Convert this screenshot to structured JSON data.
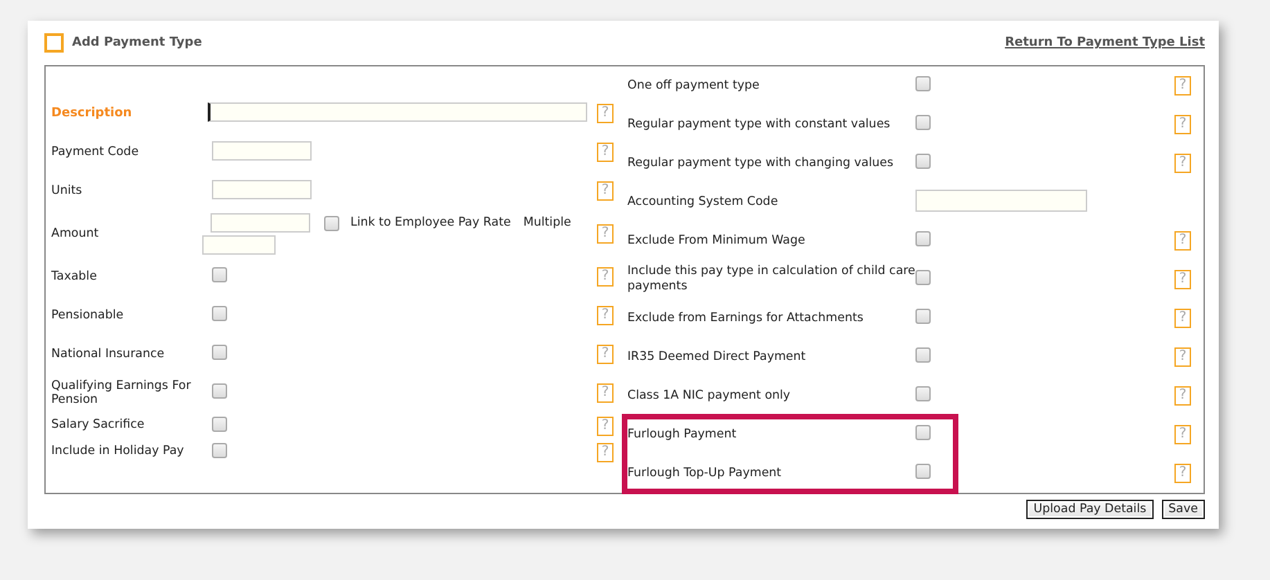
{
  "header": {
    "title": "Add Payment Type",
    "link": "Return To Payment Type List"
  },
  "left_rows": [
    {
      "kind": "text",
      "label": "Description",
      "required": true,
      "help": "?",
      "wide": true
    },
    {
      "kind": "text",
      "label": "Payment Code",
      "help": "?"
    },
    {
      "kind": "text",
      "label": "Units",
      "help": "?"
    },
    {
      "kind": "amount",
      "label": "Amount",
      "help": "?",
      "link_label": "Link to Employee Pay Rate",
      "link_checked": false,
      "multiple_label": "Multiple"
    },
    {
      "kind": "checkbox",
      "label": "Taxable",
      "checked": false,
      "help": "?"
    },
    {
      "kind": "checkbox",
      "label": "Pensionable",
      "checked": false,
      "help": "?"
    },
    {
      "kind": "checkbox",
      "label": "National Insurance",
      "checked": false,
      "help": "?"
    },
    {
      "kind": "checkbox",
      "label": "Qualifying Earnings For Pension",
      "checked": false,
      "help": "?"
    },
    {
      "kind": "checkbox",
      "label": "Salary Sacrifice",
      "checked": false,
      "help": "?",
      "compact": true
    },
    {
      "kind": "checkbox",
      "label": "Include in Holiday Pay",
      "checked": false,
      "help": "?",
      "compact": true
    }
  ],
  "right_rows": [
    {
      "kind": "checkbox",
      "label": "One off payment type",
      "checked": false,
      "help": "?"
    },
    {
      "kind": "checkbox",
      "label": "Regular payment type with constant values",
      "checked": false,
      "help": "?"
    },
    {
      "kind": "checkbox",
      "label": "Regular payment type with changing values",
      "checked": false,
      "help": "?"
    },
    {
      "kind": "text",
      "label": "Accounting System Code"
    },
    {
      "kind": "checkbox",
      "label": "Exclude From Minimum Wage",
      "checked": false,
      "help": "?"
    },
    {
      "kind": "checkbox",
      "label": "Include this pay type in calculation of child care payments",
      "checked": false,
      "help": "?"
    },
    {
      "kind": "checkbox",
      "label": "Exclude from Earnings for Attachments",
      "checked": false,
      "help": "?"
    },
    {
      "kind": "checkbox",
      "label": "IR35 Deemed Direct Payment",
      "checked": false,
      "help": "?"
    },
    {
      "kind": "checkbox",
      "label": "Class 1A NIC payment only",
      "checked": false,
      "help": "?"
    },
    {
      "kind": "checkbox",
      "label": "Furlough Payment",
      "checked": false,
      "help": "?",
      "highlighted": true
    },
    {
      "kind": "checkbox",
      "label": "Furlough Top-Up Payment",
      "checked": false,
      "help": "?",
      "highlighted": true
    }
  ],
  "buttons": [
    "Upload Pay Details",
    "Save"
  ]
}
